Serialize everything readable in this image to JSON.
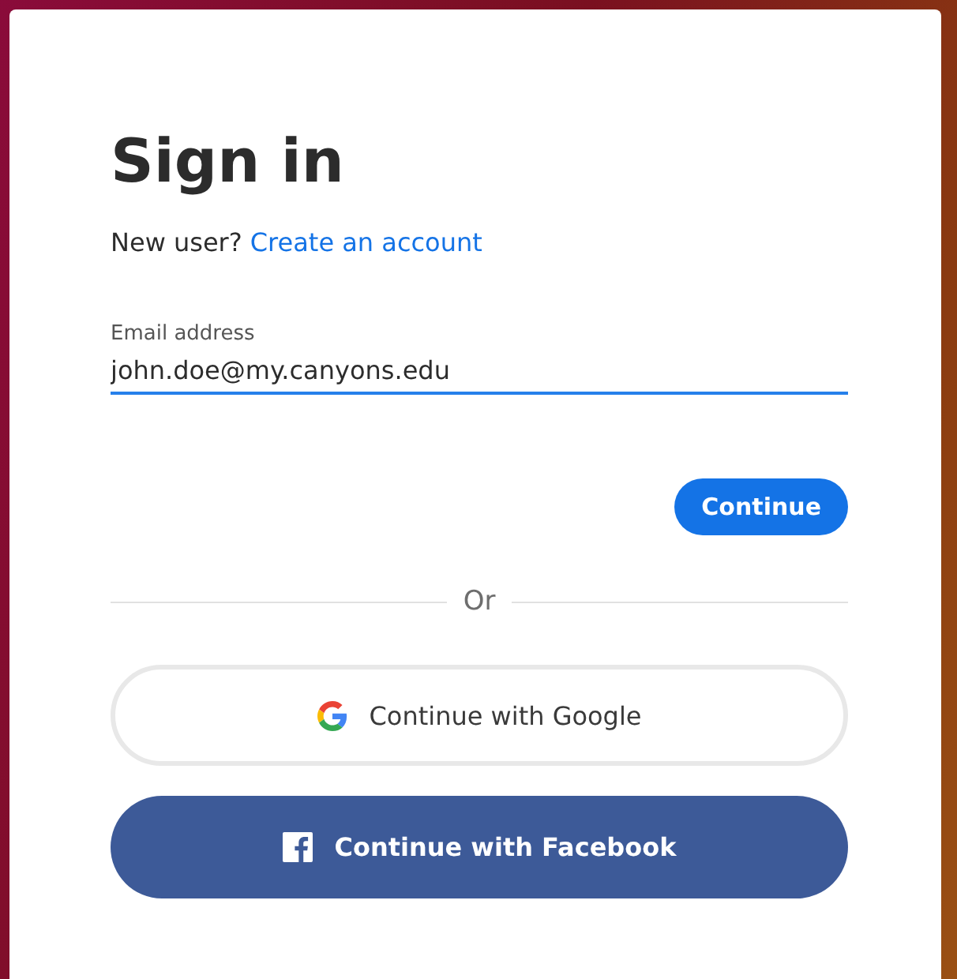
{
  "title": "Sign in",
  "signup": {
    "prompt": "New user?",
    "link": "Create an account"
  },
  "email": {
    "label": "Email address",
    "value": "john.doe@my.canyons.edu"
  },
  "continue_button": "Continue",
  "divider": "Or",
  "social_buttons": [
    {
      "kind": "google",
      "label": "Continue with Google"
    },
    {
      "kind": "facebook",
      "label": "Continue with Facebook"
    }
  ]
}
